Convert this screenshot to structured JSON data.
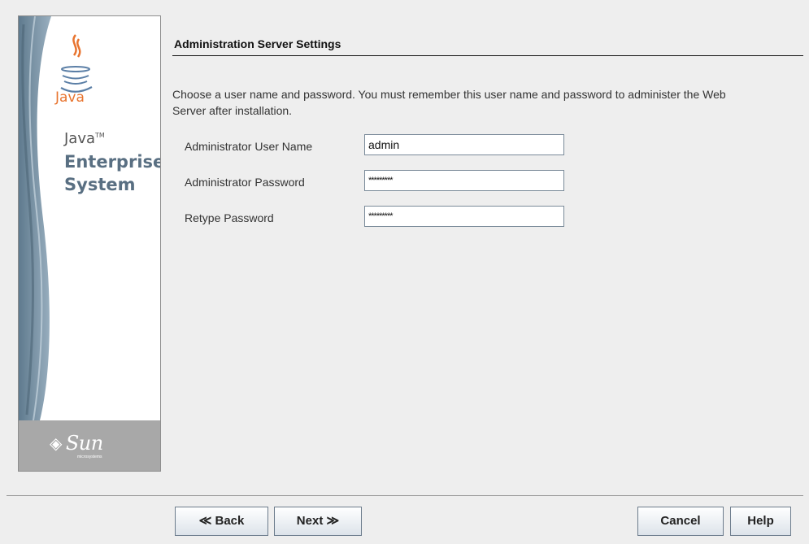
{
  "branding": {
    "java_wordmark": "Java",
    "product_line1": "Java",
    "product_tm": "TM",
    "product_line2": "Enterprise",
    "product_line3": "System",
    "vendor": "Sun",
    "vendor_sub": "microsystems"
  },
  "page": {
    "title": "Administration Server Settings",
    "instructions": "Choose a user name and password. You must remember this user name and password to administer the Web Server after installation."
  },
  "form": {
    "username_label": "Administrator User Name",
    "username_value": "admin",
    "password_label": "Administrator Password",
    "password_value": "*********",
    "retype_label": "Retype Password",
    "retype_value": "*********"
  },
  "buttons": {
    "back": "≪ Back",
    "next": "Next ≫",
    "cancel": "Cancel",
    "help": "Help"
  },
  "colors": {
    "background": "#eeeeee",
    "java_orange": "#e8742f",
    "brand_blue_gray": "#596f82",
    "sun_strip": "#a8a8a8"
  }
}
